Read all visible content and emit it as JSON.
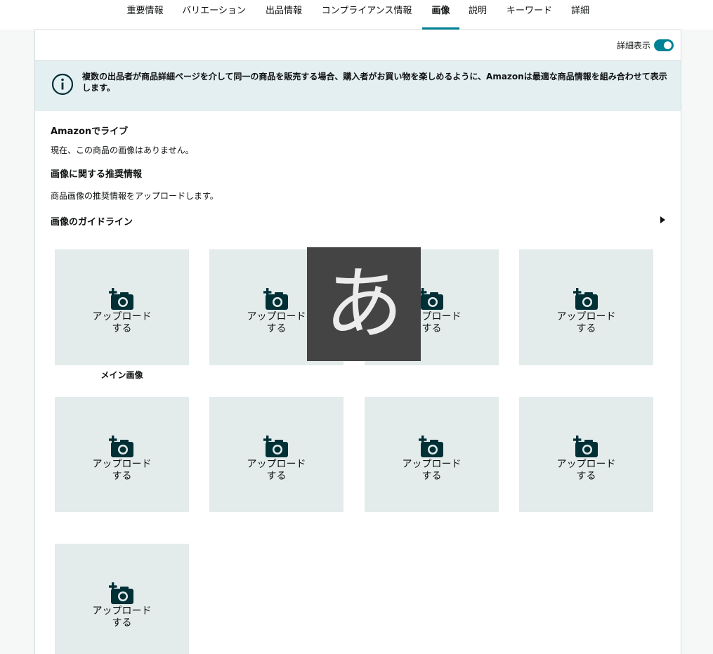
{
  "tabs": [
    {
      "label": "重要情報"
    },
    {
      "label": "バリエーション"
    },
    {
      "label": "出品情報"
    },
    {
      "label": "コンプライアンス情報"
    },
    {
      "label": "画像"
    },
    {
      "label": "説明"
    },
    {
      "label": "キーワード"
    },
    {
      "label": "詳細"
    }
  ],
  "active_tab": "画像",
  "detail_toggle": {
    "label": "詳細表示",
    "on": true
  },
  "info": {
    "text": "複数の出品者が商品詳細ページを介して同一の商品を販売する場合、購入者がお買い物を楽しめるように、Amazonは最適な商品情報を組み合わせて表示します。"
  },
  "live_section": {
    "heading": "Amazonでライブ",
    "text": "現在、この商品の画像はありません。"
  },
  "recommend_section": {
    "heading": "画像に関する推奨情報",
    "text": "商品画像の推奨情報をアップロードします。"
  },
  "guidelines": {
    "heading": "画像のガイドライン"
  },
  "upload_tile": {
    "line1": "アップロード",
    "line2": "する"
  },
  "main_image_caption": "メイン画像",
  "tile_count": 9,
  "ime_indicator": "あ",
  "colors": {
    "accent": "#008296",
    "info_bg": "#e3eff1",
    "tile_bg": "#e3ebeb",
    "icon": "#002f36"
  }
}
